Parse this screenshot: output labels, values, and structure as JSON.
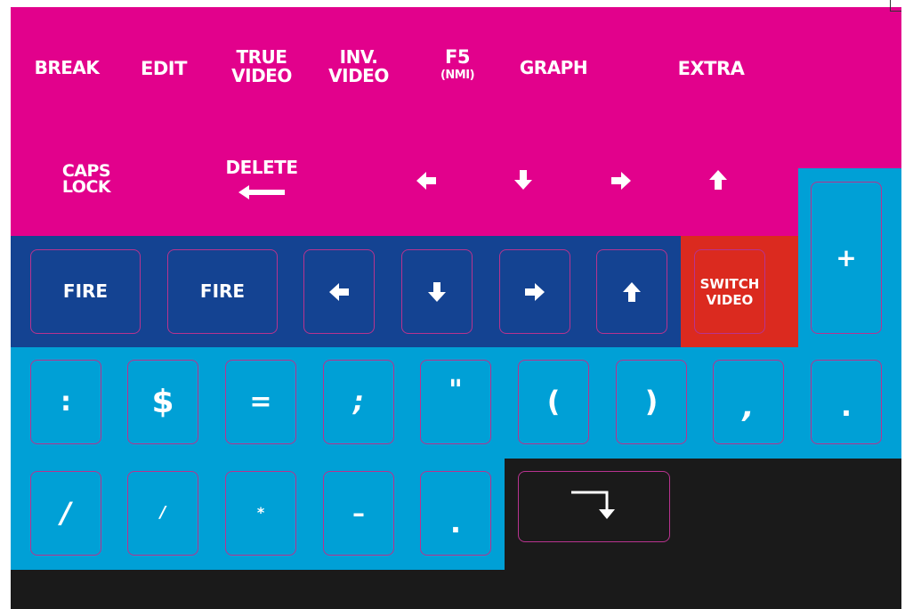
{
  "colors": {
    "magenta": "#e2018c",
    "navy": "#144392",
    "cyan": "#00a0d6",
    "red": "#db2a1f",
    "black": "#1a1a1a",
    "key_border": "#b8338f",
    "label": "#ffffff"
  },
  "top_row": {
    "break": "BREAK",
    "edit": "EDIT",
    "true_video": [
      "TRUE",
      "VIDEO"
    ],
    "inv_video": [
      "INV.",
      "VIDEO"
    ],
    "f5": "F5",
    "f5_sub": "(NMI)",
    "graph": "GRAPH",
    "extra": "EXTRA"
  },
  "second_row": {
    "caps_lock": [
      "CAPS",
      "LOCK"
    ],
    "delete": "DELETE",
    "arrows": [
      "arrow-left-icon",
      "arrow-down-icon",
      "arrow-right-icon",
      "arrow-up-icon"
    ]
  },
  "joystick_row": {
    "fire_1": "FIRE",
    "fire_2": "FIRE",
    "switch_video": [
      "SWITCH",
      "VIDEO"
    ]
  },
  "plus_key": "+",
  "symbol_row": [
    ":",
    "$",
    "=",
    ";",
    "\"",
    "(",
    ")",
    ",",
    "."
  ],
  "symbol_row_2": [
    "/",
    "/",
    "*",
    "–",
    "."
  ],
  "enter_key_icon": "enter-arrow-icon"
}
